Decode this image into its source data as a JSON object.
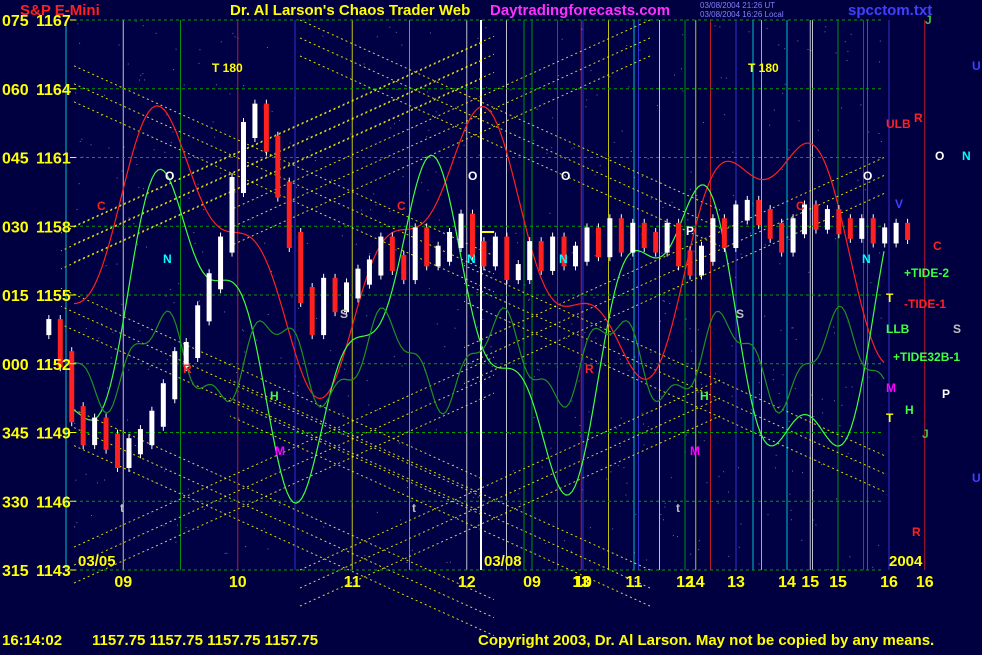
{
  "header": {
    "symbol": "S&P E-Mini",
    "title": "Dr. Al Larson's Chaos Trader Web",
    "site": "Daytradingforecasts.com",
    "small_line1": "03/08/2004 21:26 UT",
    "small_line2": "03/08/2004 16:26 Local",
    "file": "spcctom.txt"
  },
  "footer": {
    "time": "16:14:02",
    "quote": "1157.75 1157.75 1157.75 1157.75",
    "copyright": "Copyright 2003, Dr. Al Larson. May not be copied by any means."
  },
  "colors": {
    "background": "#000040",
    "grid_yellow": "#ffff00",
    "grid_green": "#00c000",
    "cyan": "#00ffff",
    "magenta": "#ff00ff",
    "white": "#ffffff",
    "red": "#ff2020",
    "blue": "#4040ff"
  },
  "chart_data": {
    "type": "candlestick",
    "title": "S&P E-Mini",
    "y_ticks": [
      {
        "label": "075",
        "value": 1167
      },
      {
        "label": "060",
        "value": 1164
      },
      {
        "label": "045",
        "value": 1161
      },
      {
        "label": "030",
        "value": 1158
      },
      {
        "label": "015",
        "value": 1155
      },
      {
        "label": "000",
        "value": 1152
      },
      {
        "label": "345",
        "value": 1149
      },
      {
        "label": "330",
        "value": 1146
      },
      {
        "label": "315",
        "value": 1143
      }
    ],
    "ylim": [
      1143,
      1167
    ],
    "x_hours": [
      "09",
      "10",
      "11",
      "12",
      "13",
      "14",
      "15",
      "16",
      "09",
      "10",
      "11",
      "12",
      "13",
      "14",
      "15",
      "16"
    ],
    "dates": [
      "03/05",
      "03/08"
    ],
    "year": "2004",
    "price_series": {
      "name": "S&P E-Mini price",
      "hours": [
        8.35,
        8.45,
        8.55,
        8.65,
        8.75,
        8.85,
        8.95,
        9.05,
        9.15,
        9.25,
        9.35,
        9.45,
        9.55,
        9.65,
        9.75,
        9.85,
        9.95,
        10.05,
        10.15,
        10.25,
        10.35,
        10.45,
        10.55,
        10.65,
        10.75,
        10.85,
        10.95,
        11.05,
        11.15,
        11.25,
        11.35,
        11.45,
        11.55,
        11.65,
        11.75,
        11.85,
        11.95,
        12.05,
        12.15,
        12.25,
        12.35,
        12.45,
        12.55,
        12.65,
        12.75,
        12.85,
        12.95,
        13.05,
        13.15,
        13.25,
        13.35,
        13.45,
        13.55,
        13.65,
        13.75,
        13.85,
        13.95,
        14.05,
        14.15,
        14.25,
        14.35,
        14.45,
        14.55,
        14.65,
        14.75,
        14.85,
        14.95,
        15.05,
        15.15,
        15.25,
        15.35,
        15.45,
        15.55,
        15.65,
        15.75,
        15.85
      ],
      "close": [
        1153.6,
        1152.2,
        1149.8,
        1148.8,
        1149.3,
        1148.6,
        1147.8,
        1148.4,
        1148.8,
        1149.6,
        1150.8,
        1152.2,
        1152.6,
        1154.2,
        1155.6,
        1157.2,
        1159.8,
        1162.2,
        1163.0,
        1161.6,
        1159.6,
        1157.4,
        1155.0,
        1153.6,
        1155.4,
        1154.6,
        1155.2,
        1155.8,
        1156.2,
        1157.2,
        1156.4,
        1156.0,
        1157.6,
        1156.6,
        1156.8,
        1157.4,
        1158.2,
        1157.0,
        1156.6,
        1157.2,
        1156.0,
        1156.0,
        1157.0,
        1156.4,
        1157.2,
        1156.6,
        1156.8,
        1157.6,
        1157.0,
        1158.0,
        1157.2,
        1157.8,
        1157.4,
        1157.2,
        1157.8,
        1156.6,
        1156.2,
        1156.8,
        1158.0,
        1157.4,
        1158.6,
        1158.8,
        1158.4,
        1157.8,
        1157.2,
        1158.0,
        1158.6,
        1158.2,
        1158.4,
        1158.0,
        1157.8,
        1158.0,
        1157.6,
        1157.6,
        1157.8,
        1157.75
      ]
    },
    "indicator_labels": [
      {
        "text": "ULB",
        "color": "#ff2020"
      },
      {
        "text": "+TIDE-2",
        "color": "#40ff40"
      },
      {
        "text": "-TIDE-1",
        "color": "#ff2020"
      },
      {
        "text": "LLB",
        "color": "#40ff40"
      },
      {
        "text": "+TIDE32B-1",
        "color": "#40ff40"
      }
    ],
    "planet_letters": [
      {
        "text": "C",
        "color": "#ff2020"
      },
      {
        "text": "O",
        "color": "#ffffff"
      },
      {
        "text": "N",
        "color": "#00ffff"
      },
      {
        "text": "R",
        "color": "#ff2020"
      },
      {
        "text": "S",
        "color": "#c0c0c0"
      },
      {
        "text": "H",
        "color": "#40ff40"
      },
      {
        "text": "M",
        "color": "#ff00ff"
      },
      {
        "text": "P",
        "color": "#ffffff"
      },
      {
        "text": "J",
        "color": "#40c040"
      },
      {
        "text": "U",
        "color": "#4040ff"
      },
      {
        "text": "V",
        "color": "#4040ff"
      },
      {
        "text": "T",
        "color": "#ffff00"
      },
      {
        "text": "t",
        "color": "#c0c0c0"
      }
    ],
    "markers": {
      "t180": "T 180"
    }
  }
}
